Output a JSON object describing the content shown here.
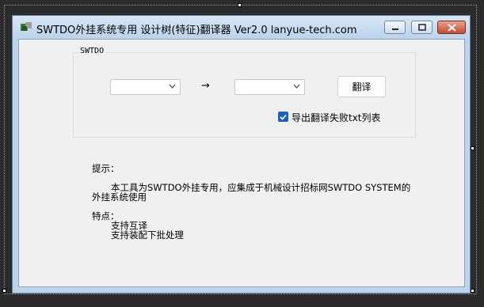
{
  "window": {
    "title": "SWTDO外挂系统专用 设计树(特征)翻译器 Ver2.0 lanyue-tech.com",
    "icon": "app-icon",
    "controls": [
      "minimize-icon",
      "maximize-icon",
      "close-icon"
    ]
  },
  "group": {
    "label": "SWTDO",
    "source_combo_value": "",
    "arrow": "→",
    "target_combo_value": "",
    "translate_button": "翻译",
    "export_checkbox_label": "导出翻译失败txt列表",
    "export_checked": true
  },
  "notes": {
    "tip_heading": "提示：",
    "tip_line1": "本工具为SWTDO外挂专用，应集成于机械设计招标网SWTDO SYSTEM的",
    "tip_line2": "外挂系统使用",
    "feature_heading": "特点：",
    "feature_item1": "支持互译",
    "feature_item2": "支持装配下批处理"
  },
  "colors": {
    "accent": "#1f5fbf",
    "titlebar": "#bcd3ec",
    "client": "#f0f0f0"
  }
}
